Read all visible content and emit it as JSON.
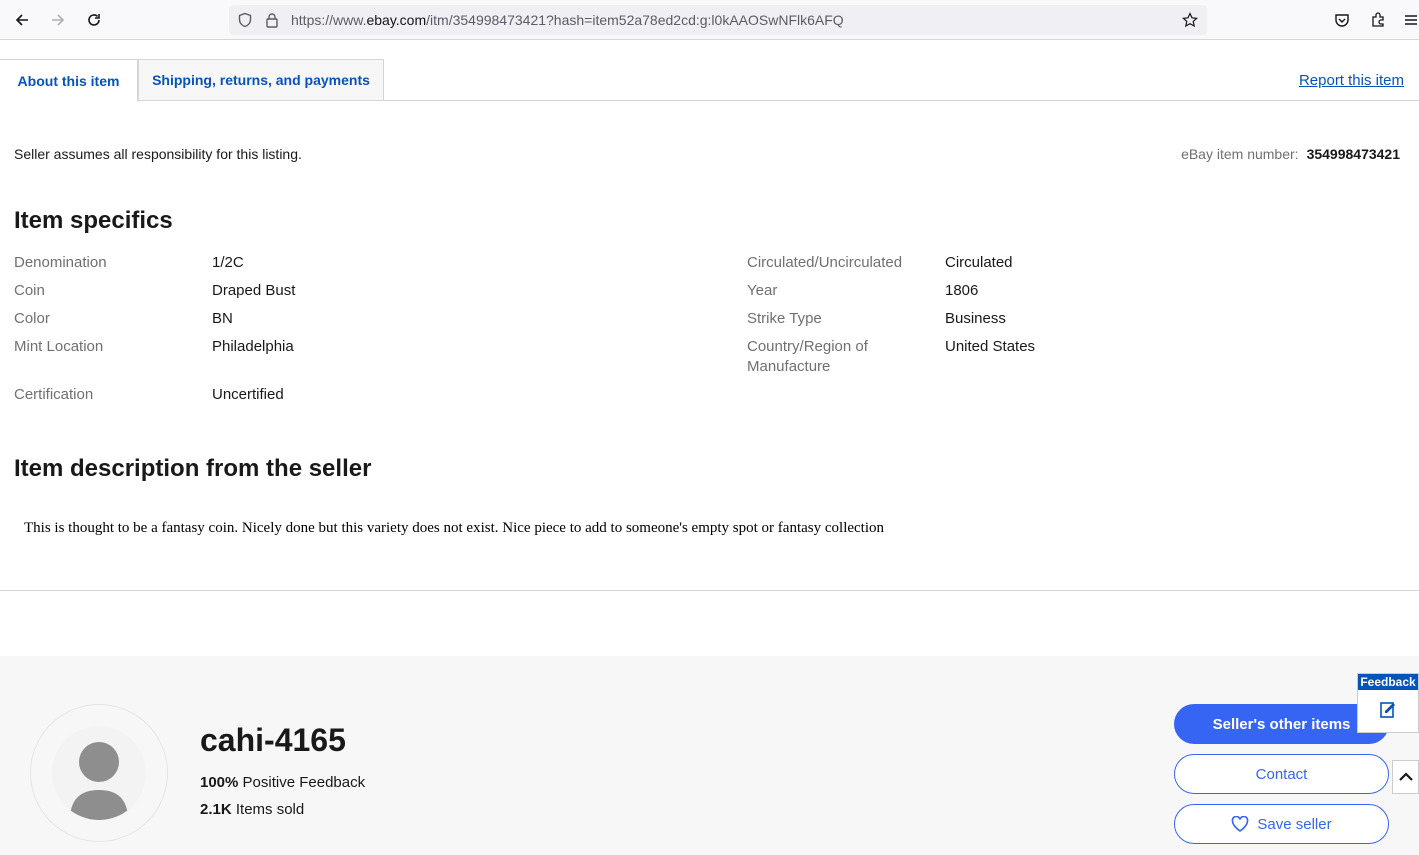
{
  "browser": {
    "url_prefix": "https://www.",
    "url_domain": "ebay.com",
    "url_path": "/itm/354998473421?hash=item52a78ed2cd:g:l0kAAOSwNFlk6AFQ"
  },
  "tabs": [
    {
      "label": "About this item"
    },
    {
      "label": "Shipping, returns, and payments"
    }
  ],
  "report_link": "Report this item",
  "seller_note": "Seller assumes all responsibility for this listing.",
  "item_number": {
    "label": "eBay item number:",
    "value": "354998473421"
  },
  "specifics": {
    "heading": "Item specifics",
    "left": [
      {
        "label": "Denomination",
        "value": "1/2C"
      },
      {
        "label": "Coin",
        "value": "Draped Bust"
      },
      {
        "label": "Color",
        "value": "BN"
      },
      {
        "label": "Mint Location",
        "value": "Philadelphia"
      },
      {
        "label": "Certification",
        "value": "Uncertified"
      }
    ],
    "right": [
      {
        "label": "Circulated/Uncirculated",
        "value": "Circulated"
      },
      {
        "label": "Year",
        "value": "1806"
      },
      {
        "label": "Strike Type",
        "value": "Business"
      },
      {
        "label": "Country/Region of Manufacture",
        "value": "United States"
      }
    ]
  },
  "description": {
    "heading": "Item description from the seller",
    "text": "This is thought to be a fantasy coin. Nicely done but this variety does not exist. Nice piece to add to someone's empty spot or fantasy collection"
  },
  "seller": {
    "name": "cahi-4165",
    "feedback_value": "100%",
    "feedback_label": "Positive Feedback",
    "sold_value": "2.1K",
    "sold_label": "Items sold",
    "btn_other_items": "Seller's other items",
    "btn_contact": "Contact",
    "btn_save": "Save seller"
  },
  "feedback_widget": {
    "label": "Feedback"
  },
  "colors": {
    "accent": "#3665f3",
    "link": "#0654ba"
  }
}
